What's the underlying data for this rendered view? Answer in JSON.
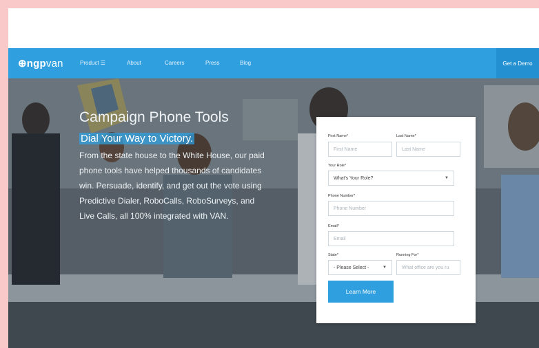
{
  "nav": {
    "logo_symbol": "⊕",
    "logo_bold": "ngp",
    "logo_light": "van",
    "items": [
      {
        "label": "Product ☰"
      },
      {
        "label": "About"
      },
      {
        "label": "Careers"
      },
      {
        "label": "Press"
      },
      {
        "label": "Blog"
      }
    ],
    "demo_label": "Get a Demo"
  },
  "hero": {
    "title": "Campaign Phone Tools",
    "subtitle": "Dial Your Way to Victory.",
    "description": "From the state house to the White House, our paid phone tools have helped thousands of candidates win. Persuade, identify, and get out the vote using Predictive Dialer, RoboCalls, RoboSurveys, and Live Calls, all 100% integrated with VAN."
  },
  "form": {
    "first_name": {
      "label": "First Name*",
      "placeholder": "First Name"
    },
    "last_name": {
      "label": "Last Name*",
      "placeholder": "Last Name"
    },
    "role": {
      "label": "Your Role*",
      "value": "What's Your Role?"
    },
    "phone": {
      "label": "Phone Number*",
      "placeholder": "Phone Number"
    },
    "email": {
      "label": "Email*",
      "placeholder": "Email"
    },
    "state": {
      "label": "State*",
      "value": "- Please Select -"
    },
    "running_for": {
      "label": "Running For*",
      "placeholder": "What office are you ru"
    },
    "submit_label": "Learn More"
  },
  "colors": {
    "accent": "#2f9fe0",
    "accent_dark": "#2390d2",
    "page_border": "#f9c9c9"
  }
}
